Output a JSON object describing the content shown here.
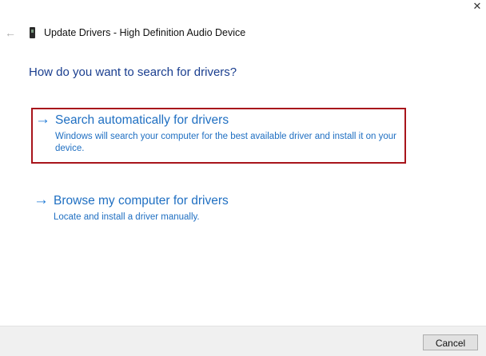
{
  "window": {
    "close_glyph": "✕",
    "back_glyph": "←",
    "title": "Update Drivers - High Definition Audio Device"
  },
  "heading": "How do you want to search for drivers?",
  "options": [
    {
      "arrow": "→",
      "title": "Search automatically for drivers",
      "description": "Windows will search your computer for the best available driver and install it on your device.",
      "selected": true
    },
    {
      "arrow": "→",
      "title": "Browse my computer for drivers",
      "description": "Locate and install a driver manually.",
      "selected": false
    }
  ],
  "footer": {
    "cancel_label": "Cancel"
  },
  "colors": {
    "accent": "#1f6fc2",
    "heading": "#1a3e8f",
    "selection": "#a8141b"
  }
}
